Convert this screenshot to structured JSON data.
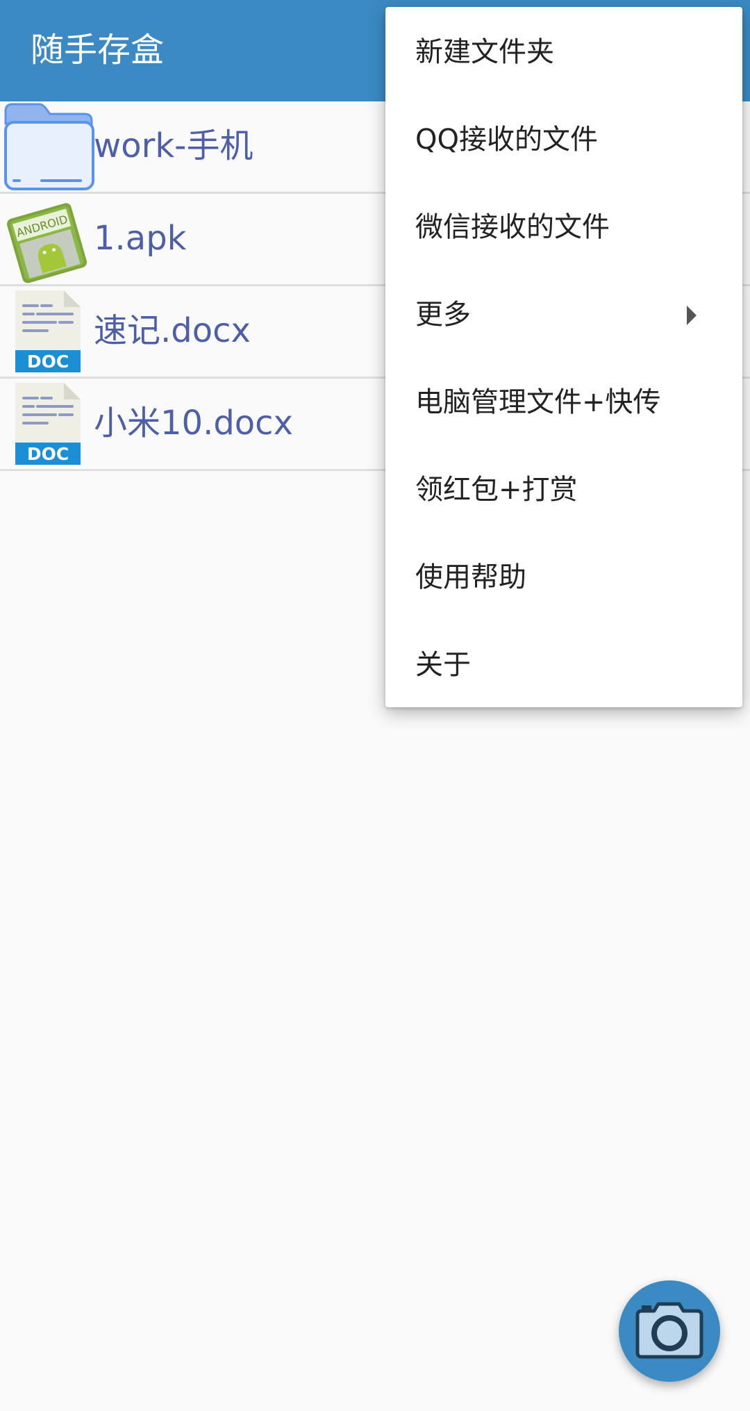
{
  "app_bar": {
    "title": "随手存盒"
  },
  "files": [
    {
      "name": "work-手机",
      "icon": "folder-icon"
    },
    {
      "name": "1.apk",
      "icon": "apk-icon"
    },
    {
      "name": "速记.docx",
      "icon": "doc-icon",
      "badge": "DOC"
    },
    {
      "name": "小米10.docx",
      "icon": "doc-icon",
      "badge": "DOC"
    }
  ],
  "overflow_menu": {
    "items": [
      {
        "label": "新建文件夹"
      },
      {
        "label": "QQ接收的文件"
      },
      {
        "label": "微信接收的文件"
      },
      {
        "label": "更多",
        "has_submenu": true
      },
      {
        "label": "电脑管理文件+快传"
      },
      {
        "label": "领红包+打赏"
      },
      {
        "label": "使用帮助"
      },
      {
        "label": "关于"
      }
    ]
  },
  "fab": {
    "icon": "camera-icon"
  },
  "colors": {
    "primary": "#3b8ac4",
    "file_name_text": "#4d5fa8",
    "background": "#fafafa",
    "divider": "#dedede"
  }
}
